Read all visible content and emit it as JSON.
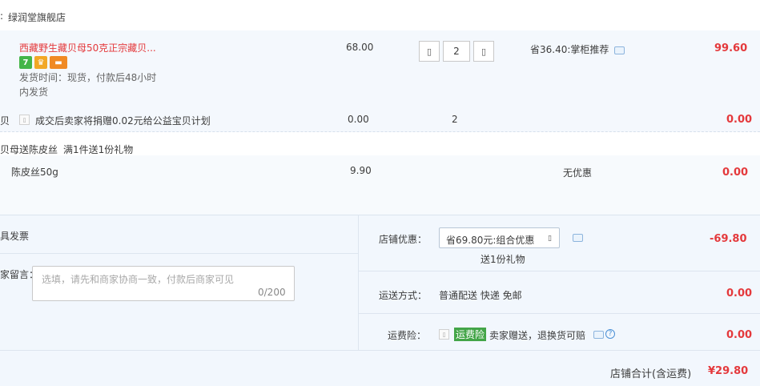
{
  "shop": {
    "name_prefix": ":",
    "name": "绿润堂旗舰店"
  },
  "item": {
    "title": "西藏野生藏贝母50克正宗藏贝...",
    "delivery_line1": "发货时间：现货，付款后48小时",
    "delivery_line2": "内发货",
    "price": "68.00",
    "qty_minus_icon": "▯",
    "qty_plus_icon": "▯",
    "quantity": "2",
    "discount": "省36.40:掌柜推荐",
    "subtotal": "99.60",
    "badges": [
      {
        "icon": "seven-day-return-icon",
        "text": "7",
        "color": "#44b549"
      },
      {
        "icon": "guarantee-shield-icon",
        "text": "♛",
        "color": "#f2a826"
      },
      {
        "icon": "credit-card-icon",
        "text": "▬",
        "color": "#f08a24"
      }
    ]
  },
  "charity": {
    "prefix": "贝",
    "text": "成交后卖家将捐赠0.02元给公益宝贝计划",
    "price": "0.00",
    "quantity": "2",
    "subtotal": "0.00"
  },
  "gift_promo": {
    "prefix": "贝母送陈皮丝",
    "text": "满1件送1份礼物"
  },
  "gift_item": {
    "name": "陈皮丝50g",
    "price": "9.90",
    "discount": "无优惠",
    "subtotal": "0.00"
  },
  "invoice": {
    "label": "具发票"
  },
  "message": {
    "label": "家留言：",
    "placeholder": "选填，请先和商家协商一致，付款后商家可见",
    "counter": "0/200"
  },
  "store_discount": {
    "label": "店铺优惠：",
    "selected": "省69.80元:组合优惠",
    "dropdown_icon": "▯",
    "note": "送1份礼物",
    "amount": "-69.80"
  },
  "shipping": {
    "label": "运送方式：",
    "value": "普通配送 快递 免邮",
    "amount": "0.00"
  },
  "insurance": {
    "label": "运费险：",
    "tag": "运费险",
    "text": "卖家赠送，退换货可赔",
    "help": "?",
    "amount": "0.00"
  },
  "total": {
    "label": "店铺合计(含运费)",
    "amount": "¥29.80"
  },
  "colors": {
    "accent_red": "#e4393c",
    "link_blue": "#4b90d6",
    "green": "#43a548"
  }
}
